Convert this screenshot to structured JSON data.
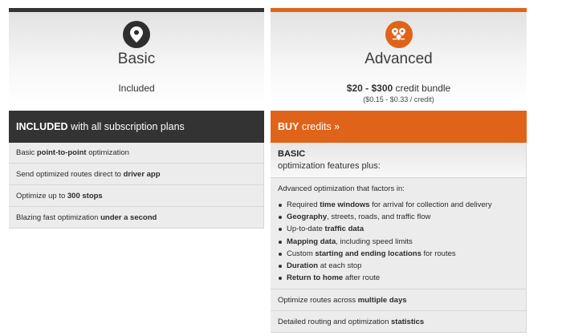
{
  "basic": {
    "name": "Basic",
    "price": "Included",
    "banner_strong": "INCLUDED",
    "banner_rest": " with all subscription plans",
    "features": [
      {
        "pre": "Basic ",
        "bold": "point-to-point",
        "post": " optimization"
      },
      {
        "pre": "Send optimized routes direct to ",
        "bold": "driver app",
        "post": ""
      },
      {
        "pre": "Optimize up to ",
        "bold": "300 stops",
        "post": ""
      },
      {
        "pre": "Blazing fast optimization ",
        "bold": "under a second",
        "post": ""
      }
    ]
  },
  "advanced": {
    "name": "Advanced",
    "price_strong": "$20 - $300",
    "price_rest": " credit bundle",
    "price_sub": "($0.15 - $0.33 / credit)",
    "banner_strong": "BUY",
    "banner_rest": " credits »",
    "basic_title": "BASIC",
    "basic_sub": "optimization features plus:",
    "intro": "Advanced optimization that factors in:",
    "bullets": [
      {
        "pre": "Required ",
        "bold": "time windows",
        "post": " for arrival for collection and delivery"
      },
      {
        "pre": "",
        "bold": "Geography",
        "post": ", streets, roads, and traffic flow"
      },
      {
        "pre": "Up-to-date ",
        "bold": "traffic data",
        "post": ""
      },
      {
        "pre": "",
        "bold": "Mapping data",
        "post": ", including speed limits"
      },
      {
        "pre": "Custom ",
        "bold": "starting and ending locations",
        "post": " for routes"
      },
      {
        "pre": "",
        "bold": "Duration",
        "post": " at each stop"
      },
      {
        "pre": "",
        "bold": "Return to home",
        "post": " after route"
      }
    ],
    "extras": [
      {
        "pre": "Optimize routes across ",
        "bold": "multiple days",
        "post": ""
      },
      {
        "pre": "Detailed routing and optimization ",
        "bold": "statistics",
        "post": ""
      }
    ]
  },
  "colors": {
    "dark": "#333333",
    "accent": "#e0631a"
  },
  "icons": {
    "basic": "map-pin-icon",
    "advanced": "multi-location-pins-icon"
  }
}
